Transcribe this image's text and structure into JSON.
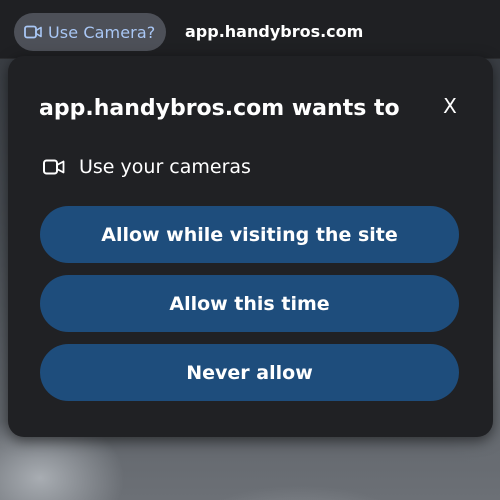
{
  "address_bar": {
    "permission_chip_label": "Use Camera?",
    "permission_chip_icon": "video-camera-icon",
    "url": "app.handybros.com"
  },
  "dialog": {
    "title": "app.handybros.com wants to",
    "close_label": "X",
    "permission": {
      "icon": "video-camera-icon",
      "label": "Use your cameras"
    },
    "buttons": [
      {
        "label": "Allow while visiting the site"
      },
      {
        "label": "Allow this time"
      },
      {
        "label": "Never allow"
      }
    ]
  },
  "colors": {
    "dialog_background": "#202124",
    "button_background": "#1e4d7c",
    "chip_background": "#4d5058",
    "chip_text": "#a9c7f5"
  }
}
